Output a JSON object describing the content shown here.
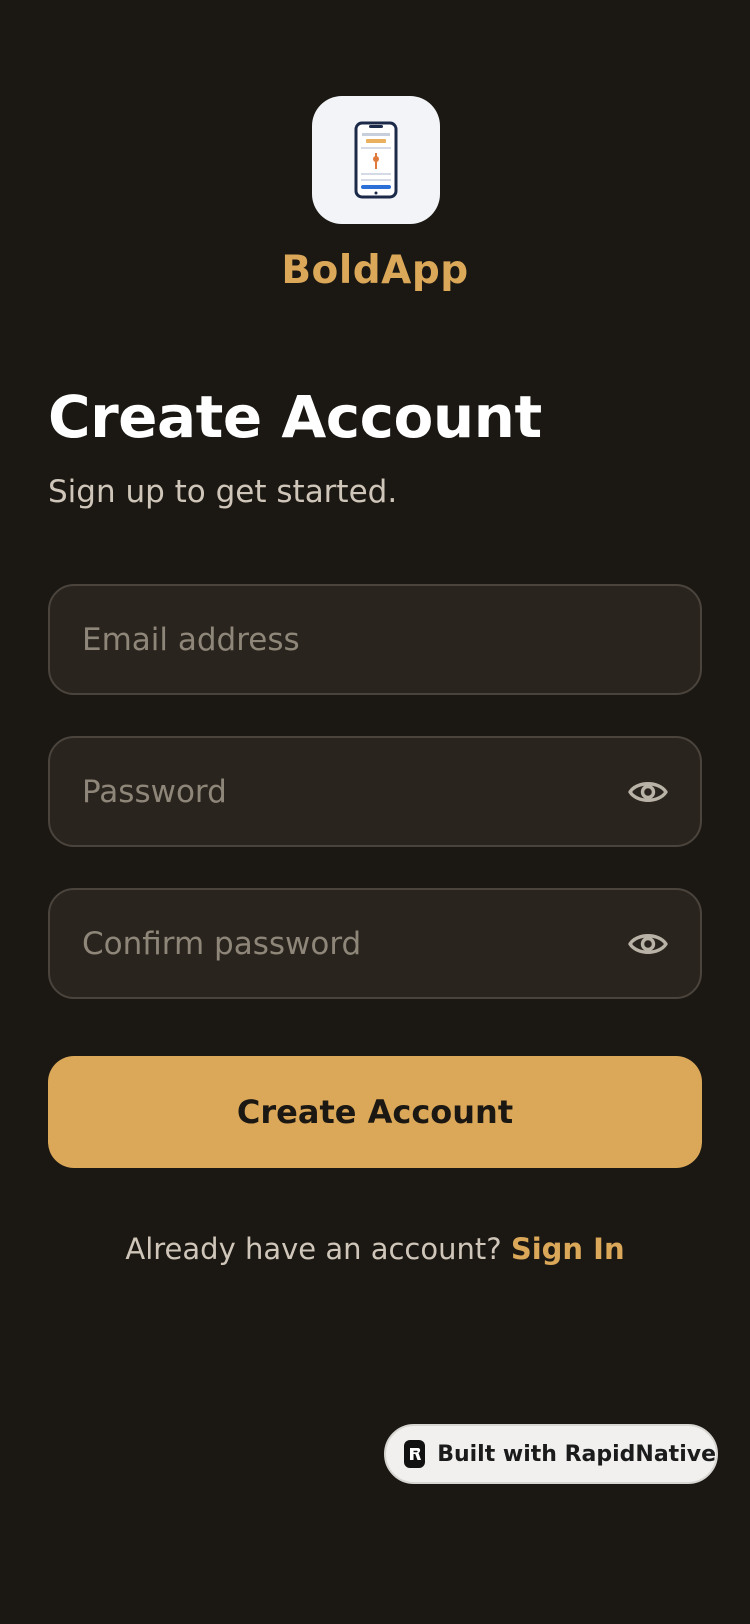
{
  "brand": {
    "app_name": "BoldApp",
    "logo_icon": "phone-illustration-icon"
  },
  "header": {
    "title": "Create Account",
    "subtitle": "Sign up to get started."
  },
  "form": {
    "email": {
      "placeholder": "Email address",
      "value": ""
    },
    "password": {
      "placeholder": "Password",
      "value": "",
      "toggle_icon": "eye-icon"
    },
    "confirm_password": {
      "placeholder": "Confirm password",
      "value": "",
      "toggle_icon": "eye-icon"
    },
    "submit_label": "Create Account"
  },
  "footer": {
    "prompt": "Already have an account?",
    "link_label": "Sign In"
  },
  "badge": {
    "label": "Built with RapidNative",
    "icon": "rapidnative-logo-icon"
  },
  "colors": {
    "background": "#1b1813",
    "accent": "#dba758",
    "field_bg": "#29241e",
    "field_border": "#4a443c",
    "muted_text": "#cfc6b9",
    "placeholder": "#8e8679"
  }
}
